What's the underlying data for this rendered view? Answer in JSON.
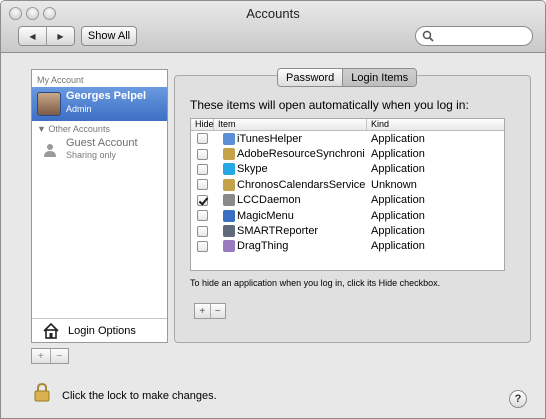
{
  "window": {
    "title": "Accounts"
  },
  "toolbar": {
    "back_icon": "back-arrow-icon",
    "forward_icon": "forward-arrow-icon",
    "show_all_label": "Show All",
    "search_value": ""
  },
  "sidebar": {
    "my_account_header": "My Account",
    "selected_account": {
      "name": "Georges Pelpel",
      "role": "Admin"
    },
    "other_accounts_header": "▼ Other Accounts",
    "guest": {
      "name": "Guest Account",
      "sub": "Sharing only"
    },
    "login_options_label": "Login Options",
    "add_label": "+",
    "remove_label": "−"
  },
  "tabs": [
    {
      "label": "Password",
      "active": false
    },
    {
      "label": "Login Items",
      "active": true
    }
  ],
  "login_items": {
    "heading": "These items will open automatically when you log in:",
    "columns": {
      "hide": "Hide",
      "item": "Item",
      "kind": "Kind"
    },
    "rows": [
      {
        "checked": false,
        "name": "iTunesHelper",
        "kind": "Application",
        "icon": "itunes-icon",
        "color": "#5b8fd6"
      },
      {
        "checked": false,
        "name": "AdobeResourceSynchroni",
        "kind": "Application",
        "icon": "adobe-icon",
        "color": "#c4a24a"
      },
      {
        "checked": false,
        "name": "Skype",
        "kind": "Application",
        "icon": "skype-icon",
        "color": "#27a8e6"
      },
      {
        "checked": false,
        "name": "ChronosCalendarsService",
        "kind": "Unknown",
        "icon": "chronos-icon",
        "color": "#c4a24a"
      },
      {
        "checked": true,
        "name": "LCCDaemon",
        "kind": "Application",
        "icon": "lcc-icon",
        "color": "#8a8a8a"
      },
      {
        "checked": false,
        "name": "MagicMenu",
        "kind": "Application",
        "icon": "magicmenu-icon",
        "color": "#3c6fc2"
      },
      {
        "checked": false,
        "name": "SMARTReporter",
        "kind": "Application",
        "icon": "smartreporter-icon",
        "color": "#5f6b7a"
      },
      {
        "checked": false,
        "name": "DragThing",
        "kind": "Application",
        "icon": "dragthing-icon",
        "color": "#9b7bbf"
      }
    ],
    "hint": "To hide an application when you log in, click its Hide checkbox.",
    "add_label": "+",
    "remove_label": "−"
  },
  "footer": {
    "lock_text": "Click the lock to make changes.",
    "help_label": "?"
  }
}
